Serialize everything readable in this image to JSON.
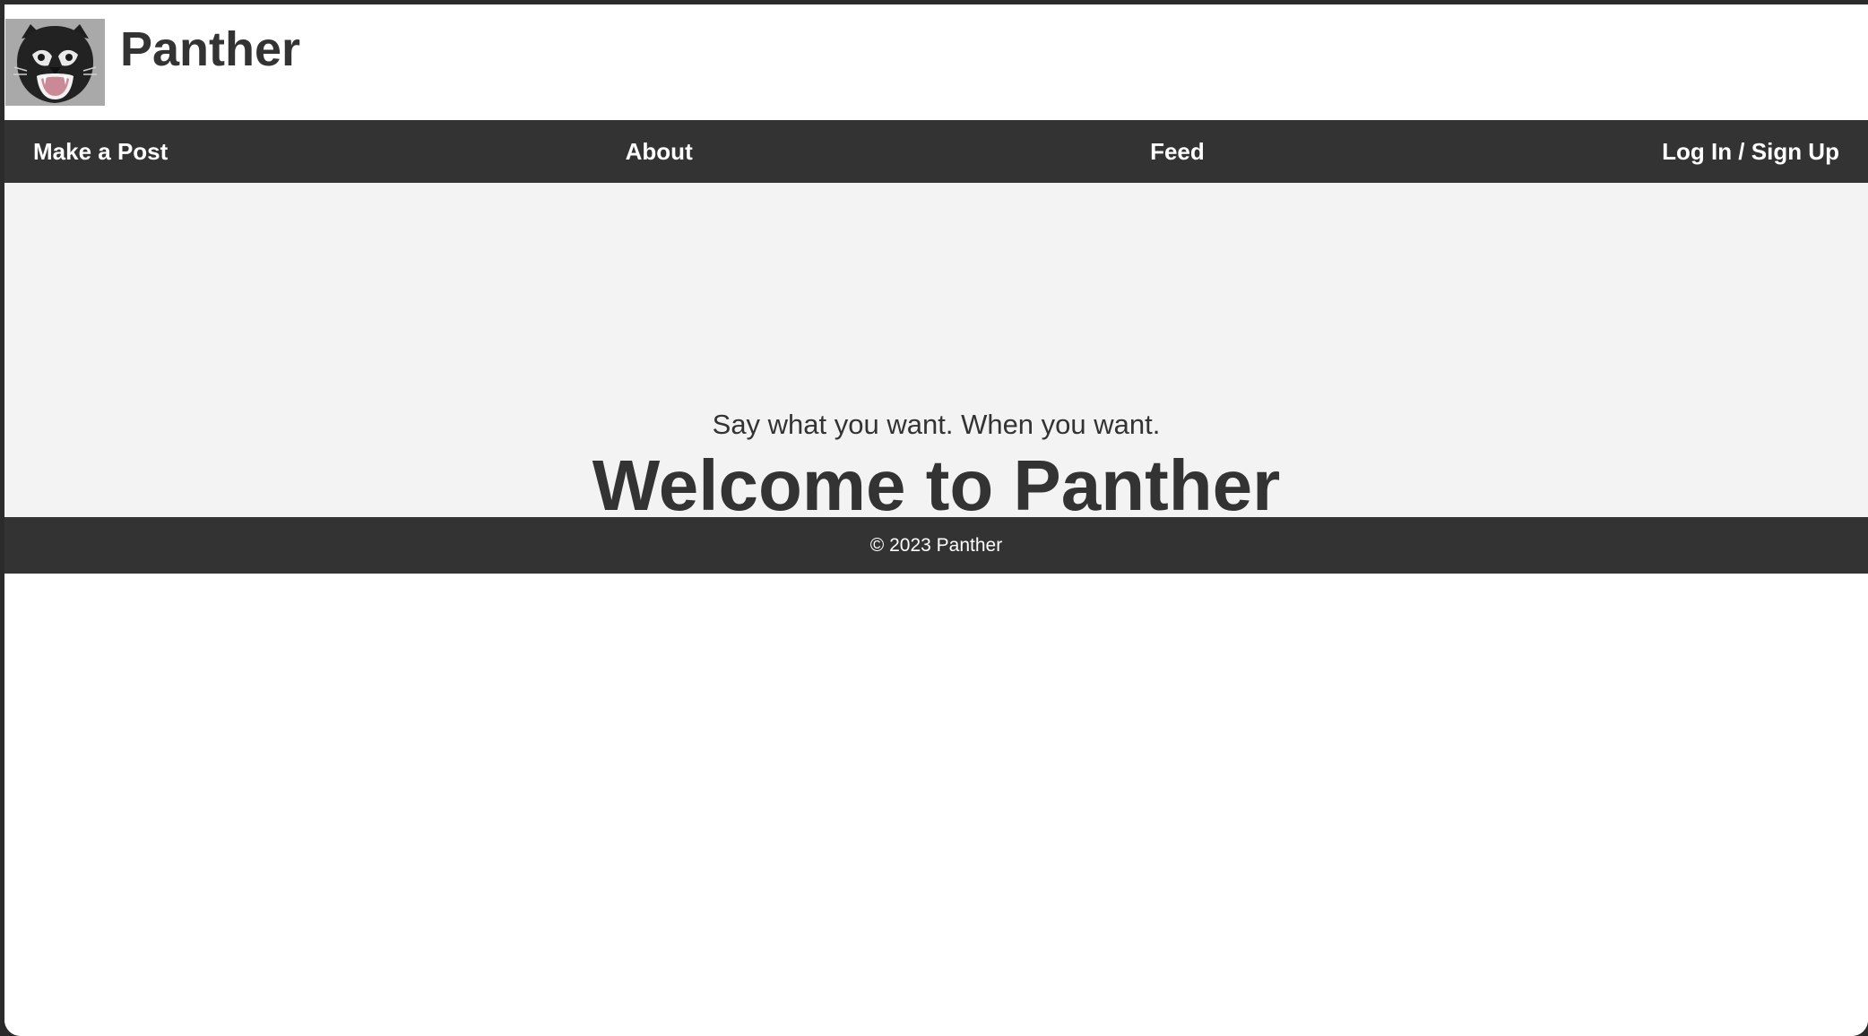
{
  "header": {
    "site_title": "Panther",
    "logo_icon": "panther-head-icon"
  },
  "nav": {
    "items": [
      {
        "label": "Make a Post"
      },
      {
        "label": "About"
      },
      {
        "label": "Feed"
      },
      {
        "label": "Log In / Sign Up"
      }
    ]
  },
  "hero": {
    "title": "Welcome to Panther",
    "tagline": "Say what you want. When you want."
  },
  "footer": {
    "text": "© 2023 Panther"
  },
  "colors": {
    "nav_background": "#333333",
    "hero_background": "#f3f3f3",
    "text_dark": "#333333",
    "nav_text": "#ffffff"
  }
}
